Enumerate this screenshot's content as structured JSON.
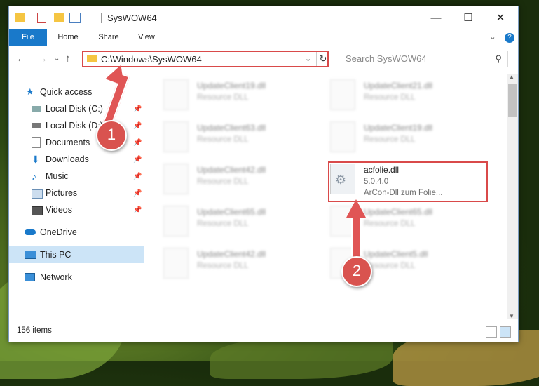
{
  "window": {
    "title": "SysWOW64"
  },
  "ribbon": {
    "tabs": [
      "File",
      "Home",
      "Share",
      "View"
    ]
  },
  "address": {
    "path": "C:\\Windows\\SysWOW64"
  },
  "search": {
    "placeholder": "Search SysWOW64"
  },
  "nav": {
    "quick_access": "Quick access",
    "items": [
      "Local Disk (C:)",
      "Local Disk (D:)",
      "Documents",
      "Downloads",
      "Music",
      "Pictures",
      "Videos"
    ],
    "onedrive": "OneDrive",
    "this_pc": "This PC",
    "network": "Network"
  },
  "files": [
    {
      "name": "UpdateClient19.dll",
      "desc": "Resource DLL"
    },
    {
      "name": "UpdateClient21.dll",
      "desc": "Resource DLL"
    },
    {
      "name": "UpdateClient63.dll",
      "desc": "Resource DLL"
    },
    {
      "name": "UpdateClient19.dll",
      "desc": "Resource DLL"
    },
    {
      "name": "UpdateClient42.dll",
      "desc": "Resource DLL"
    },
    {
      "name": "acfolie.dll",
      "version": "5.0.4.0",
      "desc": "ArCon-Dll zum Folie..."
    },
    {
      "name": "UpdateClient65.dll",
      "desc": "Resource DLL"
    },
    {
      "name": "UpdateClient65.dll",
      "desc": "Resource DLL"
    },
    {
      "name": "UpdateClient42.dll",
      "desc": "Resource DLL"
    },
    {
      "name": "UpdateClient5.dll",
      "desc": "Resource DLL"
    }
  ],
  "status": {
    "items": "156 items"
  },
  "annotations": {
    "step1": "1",
    "step2": "2"
  },
  "colors": {
    "accent": "#1979ca",
    "highlight": "#d94a4a",
    "selected": "#cce4f7"
  }
}
